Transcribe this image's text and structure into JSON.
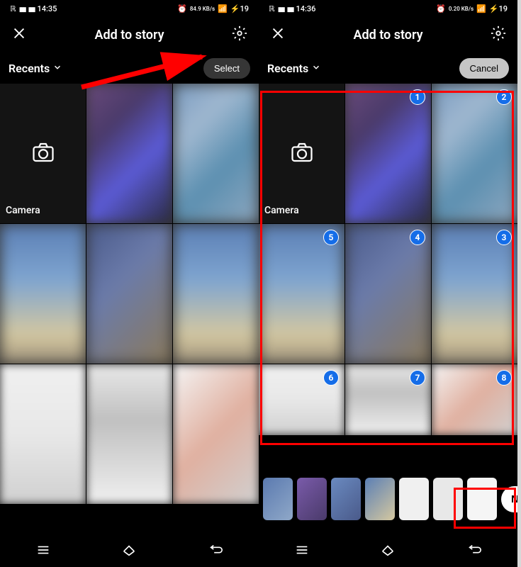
{
  "left": {
    "status": {
      "time": "14:35",
      "battery": "19",
      "extra": "84.9 KB/s"
    },
    "header": {
      "title": "Add to story"
    },
    "subheader": {
      "recents": "Recents",
      "action": "Select"
    },
    "camera_label": "Camera"
  },
  "right": {
    "status": {
      "time": "14:36",
      "battery": "19",
      "extra": "0.20 KB/s"
    },
    "header": {
      "title": "Add to story"
    },
    "subheader": {
      "recents": "Recents",
      "action": "Cancel"
    },
    "camera_label": "Camera",
    "selections": [
      "1",
      "2",
      "5",
      "4",
      "3",
      "6",
      "7",
      "8"
    ],
    "next": "Next"
  }
}
